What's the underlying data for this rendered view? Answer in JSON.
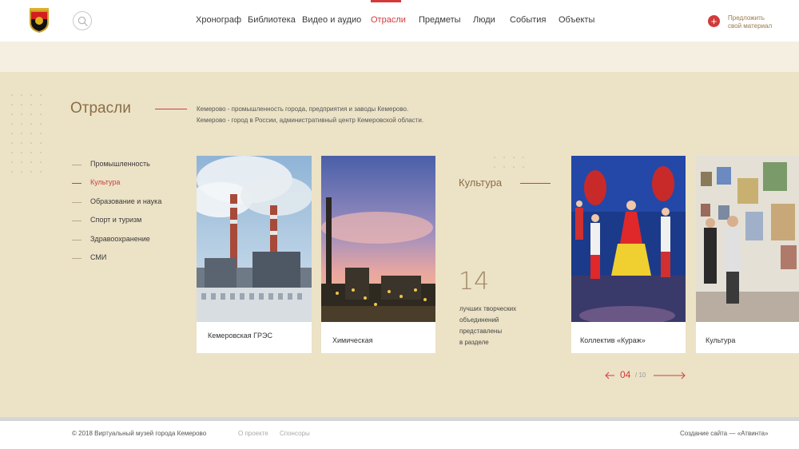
{
  "header": {
    "logo": "kemerovo-coat-of-arms",
    "search_icon": "search-icon",
    "nav": [
      {
        "label": "Хронограф",
        "active": false
      },
      {
        "label": "Библиотека",
        "active": false
      },
      {
        "label": "Видео и аудио",
        "active": false
      },
      {
        "label": "Отрасли",
        "active": true
      },
      {
        "label": "Предметы",
        "active": false
      },
      {
        "label": "Люди",
        "active": false
      },
      {
        "label": "События",
        "active": false
      },
      {
        "label": "Объекты",
        "active": false
      }
    ],
    "suggest_icon": "plus-icon",
    "suggest_line1": "Предложить",
    "suggest_line2": "свой материал"
  },
  "section": {
    "title": "Отрасли",
    "intro_line1": "Кемерово - промышленность города, предприятия и заводы Кемерово.",
    "intro_line2": "Кемерово - город в России, административный центр Кемеровской области."
  },
  "categories": [
    {
      "label": "Промышленность",
      "active": false
    },
    {
      "label": "Культура",
      "active": true
    },
    {
      "label": "Образование и наука",
      "active": false
    },
    {
      "label": "Спорт и туризм",
      "active": false
    },
    {
      "label": "Здравоохранение",
      "active": false
    },
    {
      "label": "СМИ",
      "active": false
    }
  ],
  "cards": [
    {
      "label": "Кемеровская ГРЭС"
    },
    {
      "label": "Химическая"
    },
    {
      "label": "Коллектив «Кураж»"
    },
    {
      "label": "Культура"
    }
  ],
  "culture": {
    "title": "Культура",
    "count": "14",
    "desc_lines": [
      "лучших творческих",
      "объединений",
      "представлены",
      "в разделе"
    ]
  },
  "pager": {
    "current": "04",
    "total": "/ 10",
    "prev_icon": "arrow-left-icon",
    "next_icon": "arrow-right-icon"
  },
  "footer": {
    "copyright": "© 2018 Виртуальный музей города Кемерово",
    "about": "О проекте",
    "sponsors": "Спонсоры",
    "credit": "Создание сайта — «Атвинта»"
  },
  "colors": {
    "accent": "#d23a3a",
    "band_light": "#f5efe2",
    "band_main": "#ece2c6",
    "title_brown": "#8a6e46"
  }
}
